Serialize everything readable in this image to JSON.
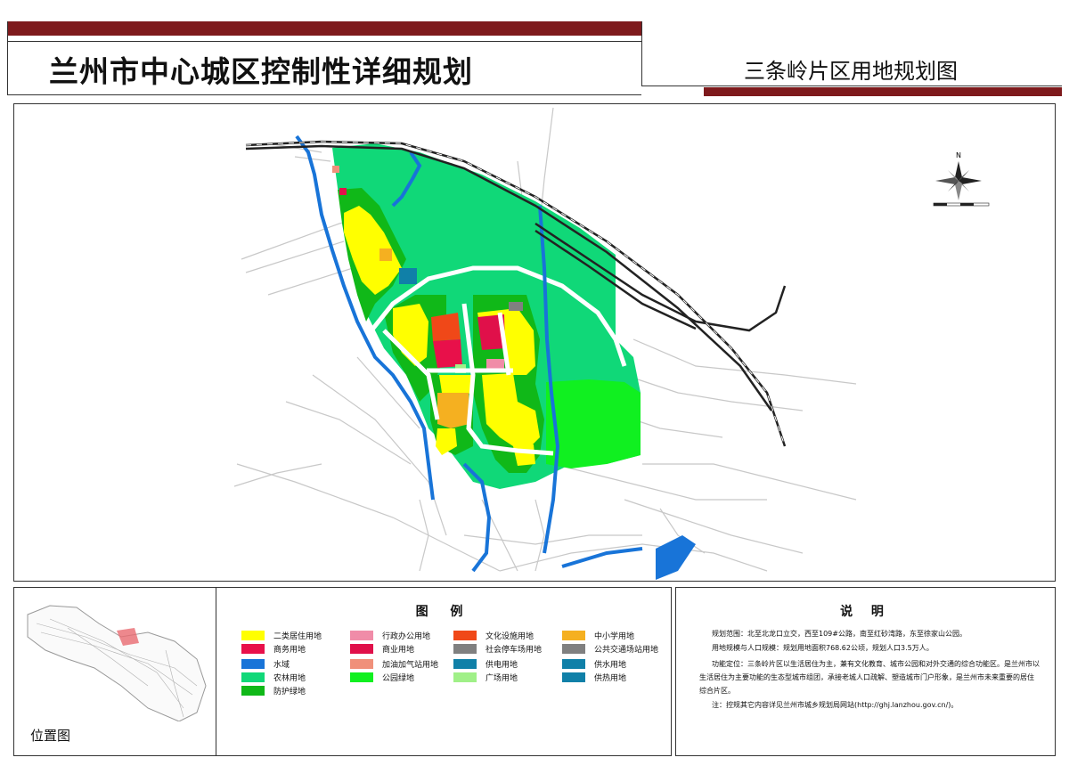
{
  "header": {
    "main_title": "兰州市中心城区控制性详细规划",
    "sub_title": "三条岭片区用地规划图",
    "accent_color": "#7e1a1c"
  },
  "location": {
    "label": "位置图"
  },
  "legend": {
    "title": "图 例",
    "items": [
      {
        "label": "二类居住用地",
        "color": "#ffff00"
      },
      {
        "label": "行政办公用地",
        "color": "#f08ca8"
      },
      {
        "label": "文化设施用地",
        "color": "#f04818"
      },
      {
        "label": "中小学用地",
        "color": "#f5b020"
      },
      {
        "label": "商务用地",
        "color": "#e8104a"
      },
      {
        "label": "商业用地",
        "color": "#e0104a"
      },
      {
        "label": "社会停车场用地",
        "color": "#808080"
      },
      {
        "label": "公共交通场站用地",
        "color": "#808080"
      },
      {
        "label": "水域",
        "color": "#1874d8"
      },
      {
        "label": "加油加气站用地",
        "color": "#f0907a"
      },
      {
        "label": "供电用地",
        "color": "#1080a8"
      },
      {
        "label": "供水用地",
        "color": "#1080a8"
      },
      {
        "label": "农林用地",
        "color": "#10d878"
      },
      {
        "label": "公园绿地",
        "color": "#10f020"
      },
      {
        "label": "广场用地",
        "color": "#a0f088"
      },
      {
        "label": "供热用地",
        "color": "#1080a8"
      },
      {
        "label": "防护绿地",
        "color": "#10b818"
      }
    ]
  },
  "notes": {
    "title": "说 明",
    "lines": [
      "规划范围：北至北龙口立交，西至109#公路，南至红砂湾路，东至徐家山公园。",
      "用地规模与人口规模：规划用地面积768.62公顷，规划人口3.5万人。",
      "功能定位：三条岭片区以生活居住为主，兼有文化教育、城市公园和对外交通的综合功能区。是兰州市以生活居住为主要功能的生态型城市组团，承接老城人口疏解、塑造城市门户形象，是兰州市未来重要的居住综合片区。",
      "注：控规其它内容详见兰州市城乡规划局网站(http://ghj.lanzhou.gov.cn/)。"
    ]
  },
  "compass": {
    "north_label": "N",
    "icon": "north-arrow-icon"
  }
}
